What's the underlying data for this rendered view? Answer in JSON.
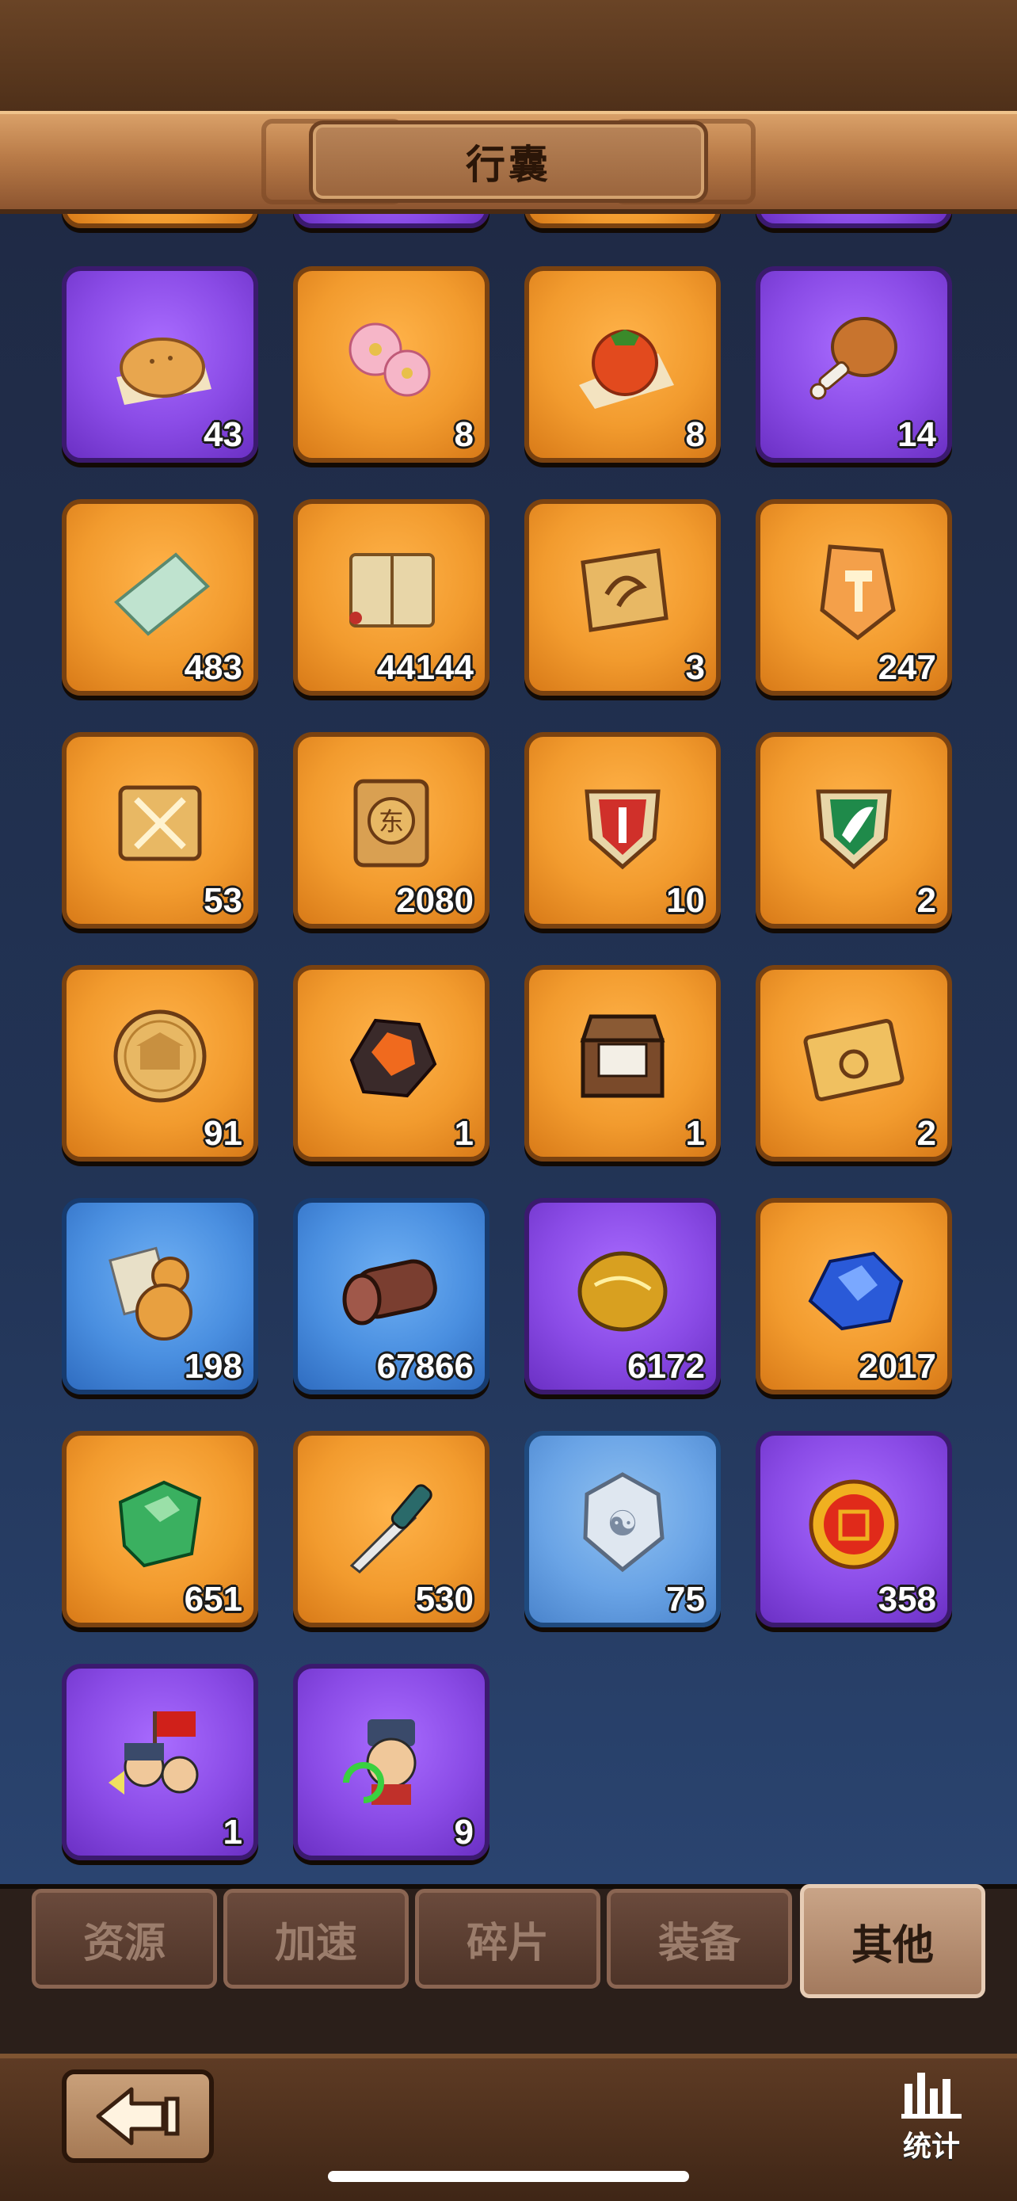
{
  "header": {
    "title": "行囊"
  },
  "inventory": {
    "partial_row": [
      {
        "color": "orange",
        "icon": "item-icon"
      },
      {
        "color": "purple",
        "icon": "item-icon"
      },
      {
        "color": "orange",
        "icon": "item-icon"
      },
      {
        "color": "purple",
        "icon": "item-icon"
      }
    ],
    "items": [
      {
        "name": "pastry-icon",
        "color": "purple",
        "count": "43"
      },
      {
        "name": "plum-blossom-icon",
        "color": "orange",
        "count": "8"
      },
      {
        "name": "persimmon-icon",
        "color": "orange",
        "count": "8"
      },
      {
        "name": "chicken-leg-icon",
        "color": "purple",
        "count": "14"
      },
      {
        "name": "jade-slab-icon",
        "color": "orange",
        "count": "483"
      },
      {
        "name": "book-icon",
        "color": "orange",
        "count": "44144"
      },
      {
        "name": "tiger-emblem-icon",
        "color": "orange",
        "count": "3"
      },
      {
        "name": "hammer-crystal-icon",
        "color": "orange",
        "count": "247"
      },
      {
        "name": "swords-puzzle-icon",
        "color": "orange",
        "count": "53"
      },
      {
        "name": "token-plaque-icon",
        "color": "orange",
        "count": "2080"
      },
      {
        "name": "red-shield-icon",
        "color": "orange",
        "count": "10"
      },
      {
        "name": "green-shield-icon",
        "color": "orange",
        "count": "2"
      },
      {
        "name": "gold-coin-icon",
        "color": "orange",
        "count": "91"
      },
      {
        "name": "lava-ore-icon",
        "color": "orange",
        "count": "1"
      },
      {
        "name": "treasure-chest-icon",
        "color": "orange",
        "count": "1"
      },
      {
        "name": "cart-ticket-icon",
        "color": "orange",
        "count": "2"
      },
      {
        "name": "gourd-icon",
        "color": "blue",
        "count": "198"
      },
      {
        "name": "wood-log-icon",
        "color": "blue",
        "count": "67866"
      },
      {
        "name": "gold-ore-icon",
        "color": "purple",
        "count": "6172"
      },
      {
        "name": "sapphire-ore-icon",
        "color": "orange",
        "count": "2017"
      },
      {
        "name": "jade-ore-icon",
        "color": "orange",
        "count": "651"
      },
      {
        "name": "dagger-icon",
        "color": "orange",
        "count": "530"
      },
      {
        "name": "silver-badge-icon",
        "color": "silver",
        "count": "75"
      },
      {
        "name": "gold-badge-icon",
        "color": "purple",
        "count": "358"
      },
      {
        "name": "army-charge-icon",
        "color": "purple",
        "count": "1"
      },
      {
        "name": "soldier-return-icon",
        "color": "purple",
        "count": "9"
      }
    ]
  },
  "tabs": [
    {
      "label": "资源",
      "active": false
    },
    {
      "label": "加速",
      "active": false
    },
    {
      "label": "碎片",
      "active": false
    },
    {
      "label": "装备",
      "active": false
    },
    {
      "label": "其他",
      "active": true
    }
  ],
  "footer": {
    "stats_label": "统计"
  },
  "colors": {
    "orange": "#f29b2e",
    "purple": "#8a4be6",
    "blue": "#4a8fe0",
    "silver": "#6aa4e6"
  }
}
